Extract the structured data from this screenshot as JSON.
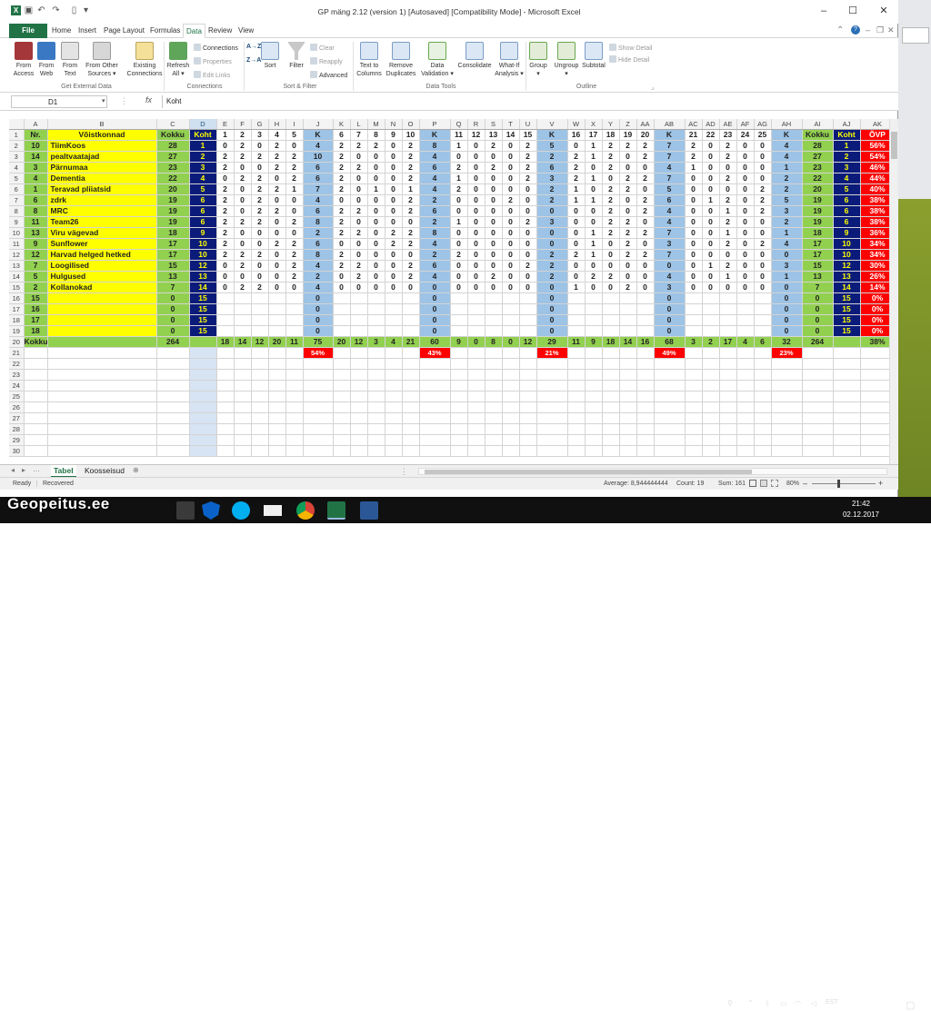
{
  "window": {
    "title": "GP mäng 2.12 (version 1) [Autosaved]  [Compatibility Mode] - Microsoft Excel",
    "help": "?"
  },
  "tabs": {
    "file": "File",
    "items": [
      "Home",
      "Insert",
      "Page Layout",
      "Formulas",
      "Data",
      "Review",
      "View"
    ],
    "active": "Data"
  },
  "ribbon": {
    "external": {
      "access": "From\nAccess",
      "web": "From\nWeb",
      "text": "From\nText",
      "other": "From Other\nSources ▾",
      "existing": "Existing\nConnections",
      "group": "Get External Data"
    },
    "connections": {
      "refresh": "Refresh\nAll ▾",
      "conn": "Connections",
      "props": "Properties",
      "edit": "Edit Links",
      "group": "Connections"
    },
    "sortfilter": {
      "az": "A→Z",
      "za": "Z→A",
      "sort": "Sort",
      "filter": "Filter",
      "clear": "Clear",
      "reapply": "Reapply",
      "advanced": "Advanced",
      "group": "Sort & Filter"
    },
    "datatools": {
      "ttc": "Text to\nColumns",
      "rd": "Remove\nDuplicates",
      "dv": "Data\nValidation ▾",
      "cons": "Consolidate",
      "wia": "What-If\nAnalysis ▾",
      "group": "Data Tools"
    },
    "outline": {
      "grp": "Group\n▾",
      "ungrp": "Ungroup\n▾",
      "sub": "Subtotal",
      "show": "Show Detail",
      "hide": "Hide Detail",
      "group": "Outline"
    }
  },
  "formula": {
    "cell": "D1",
    "fx": "fx",
    "value": "Koht"
  },
  "sheet": {
    "cols": [
      "A",
      "B",
      "C",
      "D",
      "E",
      "F",
      "G",
      "H",
      "I",
      "J",
      "K",
      "L",
      "M",
      "N",
      "O",
      "P",
      "Q",
      "R",
      "S",
      "T",
      "U",
      "V",
      "W",
      "X",
      "Y",
      "Z",
      "AA",
      "AB",
      "AC",
      "AD",
      "AE",
      "AF",
      "AG",
      "AH",
      "AI",
      "AJ",
      "AK"
    ],
    "header": [
      "Nr.",
      "Võistkonnad",
      "Kokku",
      "Koht",
      "1",
      "2",
      "3",
      "4",
      "5",
      "K",
      "6",
      "7",
      "8",
      "9",
      "10",
      "K",
      "11",
      "12",
      "13",
      "14",
      "15",
      "K",
      "16",
      "17",
      "18",
      "19",
      "20",
      "K",
      "21",
      "22",
      "23",
      "24",
      "25",
      "K",
      "Kokku",
      "Koht",
      "ÕVP"
    ],
    "rows": [
      [
        "10",
        "TiimKoos",
        "28",
        "1",
        "0",
        "2",
        "0",
        "2",
        "0",
        "4",
        "2",
        "2",
        "2",
        "0",
        "2",
        "8",
        "1",
        "0",
        "2",
        "0",
        "2",
        "5",
        "0",
        "1",
        "2",
        "2",
        "2",
        "7",
        "2",
        "0",
        "2",
        "0",
        "0",
        "4",
        "28",
        "1",
        "56%"
      ],
      [
        "14",
        "pealtvaatajad",
        "27",
        "2",
        "2",
        "2",
        "2",
        "2",
        "2",
        "10",
        "2",
        "0",
        "0",
        "0",
        "2",
        "4",
        "0",
        "0",
        "0",
        "0",
        "2",
        "2",
        "2",
        "1",
        "2",
        "0",
        "2",
        "7",
        "2",
        "0",
        "2",
        "0",
        "0",
        "4",
        "27",
        "2",
        "54%"
      ],
      [
        "3",
        "Pärnumaa",
        "23",
        "3",
        "2",
        "0",
        "0",
        "2",
        "2",
        "6",
        "2",
        "2",
        "0",
        "0",
        "2",
        "6",
        "2",
        "0",
        "2",
        "0",
        "2",
        "6",
        "2",
        "0",
        "2",
        "0",
        "0",
        "4",
        "1",
        "0",
        "0",
        "0",
        "0",
        "1",
        "23",
        "3",
        "46%"
      ],
      [
        "4",
        "Dementia",
        "22",
        "4",
        "0",
        "2",
        "2",
        "0",
        "2",
        "6",
        "2",
        "0",
        "0",
        "0",
        "2",
        "4",
        "1",
        "0",
        "0",
        "0",
        "2",
        "3",
        "2",
        "1",
        "0",
        "2",
        "2",
        "7",
        "0",
        "0",
        "2",
        "0",
        "0",
        "2",
        "22",
        "4",
        "44%"
      ],
      [
        "1",
        "Teravad pliiatsid",
        "20",
        "5",
        "2",
        "0",
        "2",
        "2",
        "1",
        "7",
        "2",
        "0",
        "1",
        "0",
        "1",
        "4",
        "2",
        "0",
        "0",
        "0",
        "0",
        "2",
        "1",
        "0",
        "2",
        "2",
        "0",
        "5",
        "0",
        "0",
        "0",
        "0",
        "2",
        "2",
        "20",
        "5",
        "40%"
      ],
      [
        "6",
        "zdrk",
        "19",
        "6",
        "2",
        "0",
        "2",
        "0",
        "0",
        "4",
        "0",
        "0",
        "0",
        "0",
        "2",
        "2",
        "0",
        "0",
        "0",
        "2",
        "0",
        "2",
        "1",
        "1",
        "2",
        "0",
        "2",
        "6",
        "0",
        "1",
        "2",
        "0",
        "2",
        "5",
        "19",
        "6",
        "38%"
      ],
      [
        "8",
        "MRC",
        "19",
        "6",
        "2",
        "0",
        "2",
        "2",
        "0",
        "6",
        "2",
        "2",
        "0",
        "0",
        "2",
        "6",
        "0",
        "0",
        "0",
        "0",
        "0",
        "0",
        "0",
        "0",
        "2",
        "0",
        "2",
        "4",
        "0",
        "0",
        "1",
        "0",
        "2",
        "3",
        "19",
        "6",
        "38%"
      ],
      [
        "11",
        "Team26",
        "19",
        "6",
        "2",
        "2",
        "2",
        "0",
        "2",
        "8",
        "2",
        "0",
        "0",
        "0",
        "0",
        "2",
        "1",
        "0",
        "0",
        "0",
        "2",
        "3",
        "0",
        "0",
        "2",
        "2",
        "0",
        "4",
        "0",
        "0",
        "2",
        "0",
        "0",
        "2",
        "19",
        "6",
        "38%"
      ],
      [
        "13",
        "Viru vägevad",
        "18",
        "9",
        "2",
        "0",
        "0",
        "0",
        "0",
        "2",
        "2",
        "2",
        "0",
        "2",
        "2",
        "8",
        "0",
        "0",
        "0",
        "0",
        "0",
        "0",
        "0",
        "1",
        "2",
        "2",
        "2",
        "7",
        "0",
        "0",
        "1",
        "0",
        "0",
        "1",
        "18",
        "9",
        "36%"
      ],
      [
        "9",
        "Sunflower",
        "17",
        "10",
        "2",
        "0",
        "0",
        "2",
        "2",
        "6",
        "0",
        "0",
        "0",
        "2",
        "2",
        "4",
        "0",
        "0",
        "0",
        "0",
        "0",
        "0",
        "0",
        "1",
        "0",
        "2",
        "0",
        "3",
        "0",
        "0",
        "2",
        "0",
        "2",
        "4",
        "17",
        "10",
        "34%"
      ],
      [
        "12",
        "Harvad helged hetked",
        "17",
        "10",
        "2",
        "2",
        "2",
        "0",
        "2",
        "8",
        "2",
        "0",
        "0",
        "0",
        "0",
        "2",
        "2",
        "0",
        "0",
        "0",
        "0",
        "2",
        "2",
        "1",
        "0",
        "2",
        "2",
        "7",
        "0",
        "0",
        "0",
        "0",
        "0",
        "0",
        "17",
        "10",
        "34%"
      ],
      [
        "7",
        "Loogilised",
        "15",
        "12",
        "0",
        "2",
        "0",
        "0",
        "2",
        "4",
        "2",
        "2",
        "0",
        "0",
        "2",
        "6",
        "0",
        "0",
        "0",
        "0",
        "2",
        "2",
        "0",
        "0",
        "0",
        "0",
        "0",
        "0",
        "0",
        "1",
        "2",
        "0",
        "0",
        "3",
        "15",
        "12",
        "30%"
      ],
      [
        "5",
        "Hulgused",
        "13",
        "13",
        "0",
        "0",
        "0",
        "0",
        "2",
        "2",
        "0",
        "2",
        "0",
        "0",
        "2",
        "4",
        "0",
        "0",
        "2",
        "0",
        "0",
        "2",
        "0",
        "2",
        "2",
        "0",
        "0",
        "4",
        "0",
        "0",
        "1",
        "0",
        "0",
        "1",
        "13",
        "13",
        "26%"
      ],
      [
        "2",
        "Kollanokad",
        "7",
        "14",
        "0",
        "2",
        "2",
        "0",
        "0",
        "4",
        "0",
        "0",
        "0",
        "0",
        "0",
        "0",
        "0",
        "0",
        "0",
        "0",
        "0",
        "0",
        "1",
        "0",
        "0",
        "2",
        "0",
        "3",
        "0",
        "0",
        "0",
        "0",
        "0",
        "0",
        "7",
        "14",
        "14%"
      ],
      [
        "15",
        "",
        "0",
        "15",
        "",
        "",
        "",
        "",
        "",
        "0",
        "",
        "",
        "",
        "",
        "",
        "0",
        "",
        "",
        "",
        "",
        "",
        "0",
        "",
        "",
        "",
        "",
        "",
        "0",
        "",
        "",
        "",
        "",
        "",
        "0",
        "0",
        "15",
        "0%"
      ],
      [
        "16",
        "",
        "0",
        "15",
        "",
        "",
        "",
        "",
        "",
        "0",
        "",
        "",
        "",
        "",
        "",
        "0",
        "",
        "",
        "",
        "",
        "",
        "0",
        "",
        "",
        "",
        "",
        "",
        "0",
        "",
        "",
        "",
        "",
        "",
        "0",
        "0",
        "15",
        "0%"
      ],
      [
        "17",
        "",
        "0",
        "15",
        "",
        "",
        "",
        "",
        "",
        "0",
        "",
        "",
        "",
        "",
        "",
        "0",
        "",
        "",
        "",
        "",
        "",
        "0",
        "",
        "",
        "",
        "",
        "",
        "0",
        "",
        "",
        "",
        "",
        "",
        "0",
        "0",
        "15",
        "0%"
      ],
      [
        "18",
        "",
        "0",
        "15",
        "",
        "",
        "",
        "",
        "",
        "0",
        "",
        "",
        "",
        "",
        "",
        "0",
        "",
        "",
        "",
        "",
        "",
        "0",
        "",
        "",
        "",
        "",
        "",
        "0",
        "",
        "",
        "",
        "",
        "",
        "0",
        "0",
        "15",
        "0%"
      ]
    ],
    "totals": [
      "Kokku",
      "",
      "264",
      "",
      "18",
      "14",
      "12",
      "20",
      "11",
      "75",
      "20",
      "12",
      "3",
      "4",
      "21",
      "60",
      "9",
      "0",
      "8",
      "0",
      "12",
      "29",
      "11",
      "9",
      "18",
      "14",
      "16",
      "68",
      "3",
      "2",
      "17",
      "4",
      "6",
      "32",
      "264",
      "",
      "38%"
    ],
    "pcts": {
      "J": "54%",
      "P": "43%",
      "V": "21%",
      "AB": "49%",
      "AH": "23%"
    }
  },
  "sheettabs": [
    "Tabel",
    "Koosseisud"
  ],
  "status": {
    "ready": "Ready",
    "recovered": "Recovered",
    "average": "Average: 8,944444444",
    "count": "Count: 19",
    "sum": "Sum: 161",
    "zoom": "80%"
  },
  "taskbar": {
    "lang": "EST",
    "time": "21:42",
    "date": "02.12.2017"
  },
  "brand": "Geopeitus.ee"
}
